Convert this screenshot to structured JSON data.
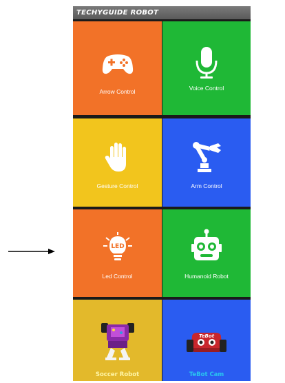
{
  "app": {
    "title": "TECHYGUIDE ROBOT"
  },
  "tiles": [
    {
      "label": "Arrow Control",
      "icon": "gamepad-icon",
      "color": "#f27228"
    },
    {
      "label": "Voice Control",
      "icon": "microphone-icon",
      "color": "#1fb836"
    },
    {
      "label": "Gesture Control",
      "icon": "hand-icon",
      "color": "#f2c51d"
    },
    {
      "label": "Arm Control",
      "icon": "robot-arm-icon",
      "color": "#2a5cf1"
    },
    {
      "label": "Led Control",
      "icon": "led-bulb-icon",
      "color": "#f27228",
      "icon_text": "LED"
    },
    {
      "label": "Humanoid Robot",
      "icon": "robot-head-icon",
      "color": "#1fb836"
    },
    {
      "label": "Soccer Robot",
      "icon": "soccer-robot-image",
      "color": "#e3b92b"
    },
    {
      "label": "TeBot Cam",
      "icon": "tebot-car-image",
      "color": "#2a5cf1",
      "icon_text": "TeBot"
    }
  ]
}
